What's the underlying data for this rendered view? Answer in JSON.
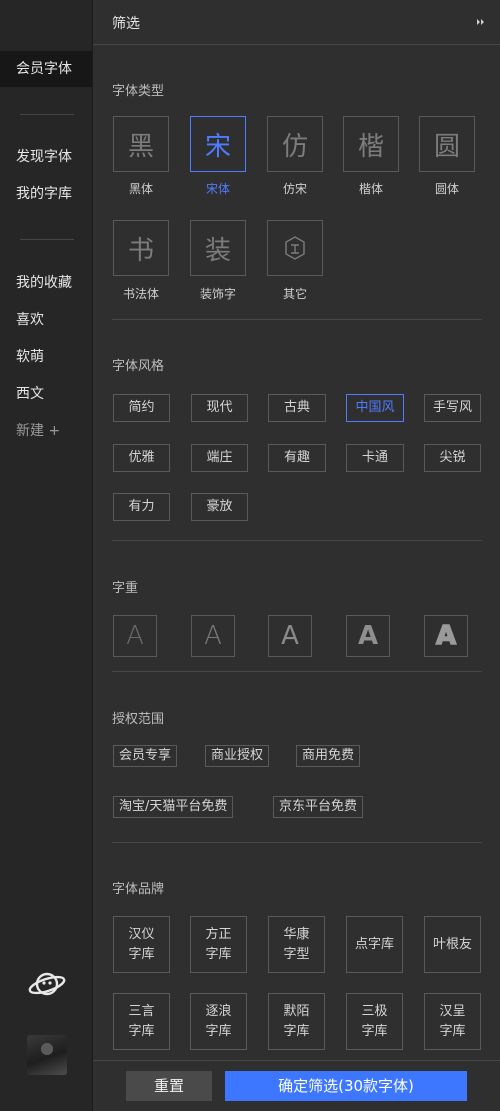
{
  "colors": {
    "accent": "#4f7cff",
    "confirm": "#3d77ff",
    "panel": "#2f2f2f",
    "sidebar": "#262626"
  },
  "sidebar": {
    "items": [
      {
        "label": "会员字体"
      },
      {
        "label": "发现字体"
      },
      {
        "label": "我的字库"
      },
      {
        "label": "我的收藏"
      },
      {
        "label": "喜欢"
      },
      {
        "label": "软萌"
      },
      {
        "label": "西文"
      },
      {
        "label": "新建 +"
      }
    ],
    "planet_icon": "planet-icon",
    "avatar": "user-avatar"
  },
  "header": {
    "title": "筛选",
    "collapse_icon": "double-chevron-right-icon"
  },
  "font_type": {
    "title": "字体类型",
    "items": [
      {
        "glyph": "黑",
        "label": "黑体"
      },
      {
        "glyph": "宋",
        "label": "宋体"
      },
      {
        "glyph": "仿",
        "label": "仿宋"
      },
      {
        "glyph": "楷",
        "label": "楷体"
      },
      {
        "glyph": "圆",
        "label": "圆体"
      },
      {
        "glyph": "书",
        "label": "书法体"
      },
      {
        "glyph": "装",
        "label": "装饰字"
      },
      {
        "glyph": "",
        "label": "其它"
      }
    ],
    "selected": "宋体"
  },
  "font_style": {
    "title": "字体风格",
    "items": [
      "简约",
      "现代",
      "古典",
      "中国风",
      "手写风",
      "优雅",
      "端庄",
      "有趣",
      "卡通",
      "尖锐",
      "有力",
      "豪放"
    ],
    "selected": "中国风"
  },
  "font_weight": {
    "title": "字重",
    "glyph": "A"
  },
  "license": {
    "title": "授权范围",
    "items": [
      "会员专享",
      "商业授权",
      "商用免费",
      "淘宝/天猫平台免费",
      "京东平台免费"
    ]
  },
  "brand": {
    "title": "字体品牌",
    "items": [
      [
        "汉仪",
        "字库"
      ],
      [
        "方正",
        "字库"
      ],
      [
        "华康",
        "字型"
      ],
      [
        "点字库"
      ],
      [
        "叶根友"
      ],
      [
        "三言",
        "字库"
      ],
      [
        "逐浪",
        "字库"
      ],
      [
        "默陌",
        "字库"
      ],
      [
        "三极",
        "字库"
      ],
      [
        "汉呈",
        "字库"
      ]
    ]
  },
  "footer": {
    "reset_label": "重置",
    "confirm_label": "确定筛选(30款字体)"
  }
}
